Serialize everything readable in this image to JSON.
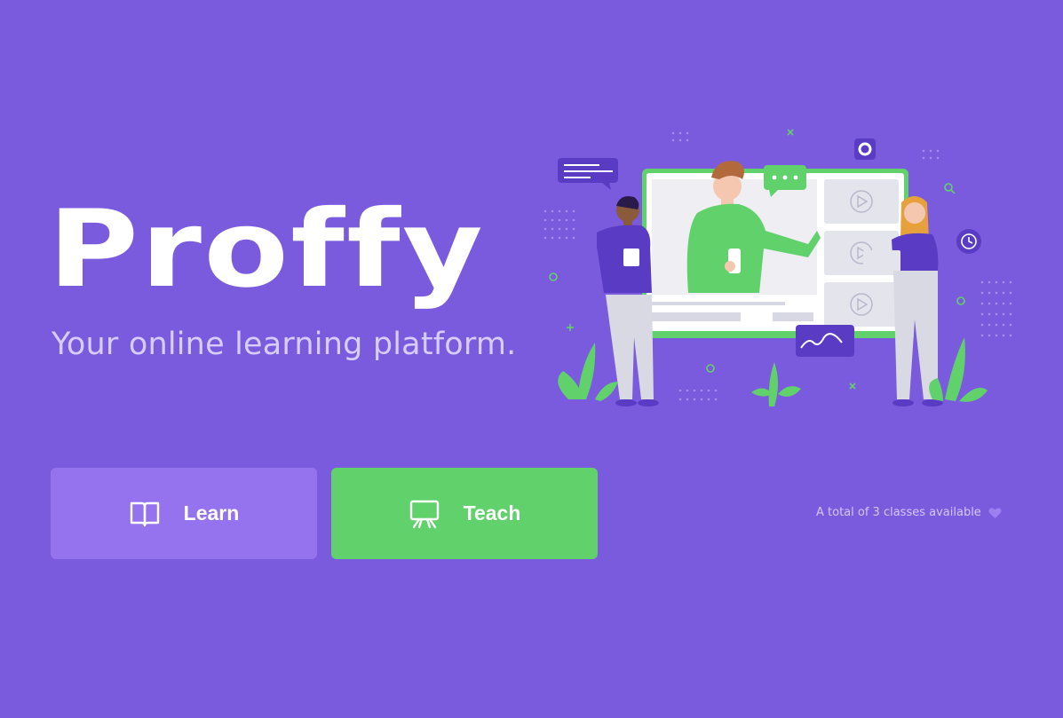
{
  "brand": {
    "name": "Proffy",
    "tagline": "Your online learning platform."
  },
  "actions": {
    "learn_label": "Learn",
    "teach_label": "Teach"
  },
  "stats": {
    "total_text": "A total of 3 classes available"
  },
  "icons": {
    "learn": "book-icon",
    "teach": "presentation-icon",
    "stats": "heart-icon"
  },
  "colors": {
    "background": "#7b5bdd",
    "learn_button": "#9673ee",
    "teach_button": "#61d16c",
    "accent_green": "#61d16c",
    "tagline": "#d8ccfb"
  }
}
